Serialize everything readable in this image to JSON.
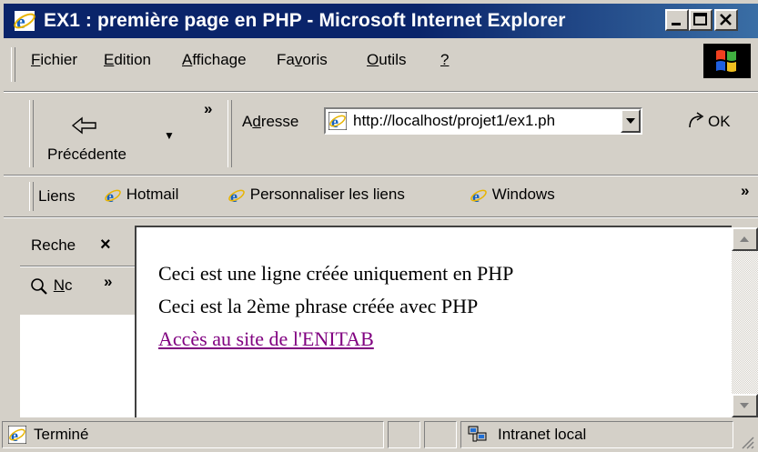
{
  "window": {
    "title": "EX1 : première page en PHP - Microsoft Internet Explorer"
  },
  "menu": [
    {
      "pre": "",
      "ul": "F",
      "post": "ichier"
    },
    {
      "pre": "",
      "ul": "E",
      "post": "dition"
    },
    {
      "pre": "",
      "ul": "A",
      "post": "ffichage"
    },
    {
      "pre": "Fa",
      "ul": "v",
      "post": "oris"
    },
    {
      "pre": "",
      "ul": "O",
      "post": "utils"
    },
    {
      "pre": "",
      "ul": "?",
      "post": ""
    }
  ],
  "toolbar": {
    "back_label": "Précédente",
    "chevron": "»"
  },
  "address": {
    "label_pre": "A",
    "label_ul": "d",
    "label_post": "resse",
    "url": "http://localhost/projet1/ex1.ph",
    "go_label": "OK"
  },
  "links": {
    "label": "Liens",
    "items": [
      "Hotmail",
      "Personnaliser les liens",
      "Windows"
    ],
    "chevron": "»"
  },
  "explorer_bar": {
    "title": "Reche",
    "close": "×",
    "button_label_ul": "N",
    "button_label_post": "c",
    "chevron": "»"
  },
  "content": {
    "line1": "Ceci est une ligne créée uniquement en PHP",
    "line2": "Ceci est la 2ème phrase créée avec PHP",
    "link": "Accès au site de l'ENITAB"
  },
  "status": {
    "text": "Terminé",
    "zone": "Intranet local"
  },
  "colors": {
    "titlebar": "#0a246a",
    "face": "#d4d0c8",
    "link_visited": "#800080"
  },
  "icons": [
    "ie-icon",
    "back-arrow-icon",
    "go-icon",
    "search-icon",
    "windows-flag-icon",
    "intranet-icon"
  ]
}
